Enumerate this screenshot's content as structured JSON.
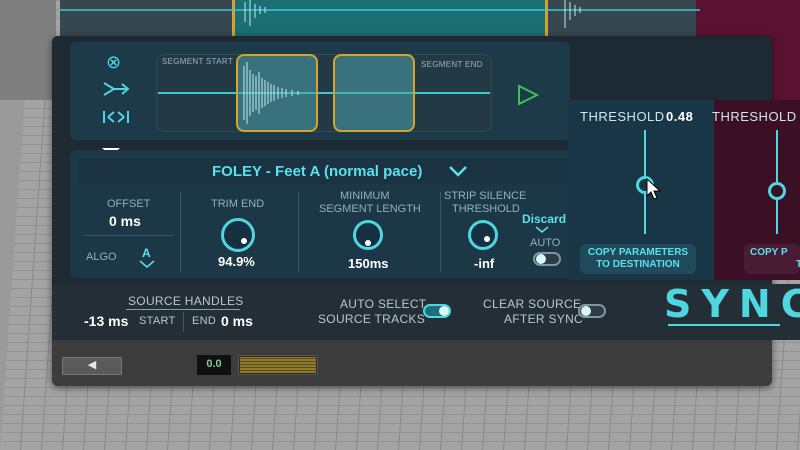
{
  "segment_editor": {
    "start_label": "SEGMENT START",
    "end_label": "SEGMENT END"
  },
  "preset": {
    "name": "FOLEY - Feet A (normal pace)"
  },
  "params": {
    "offset_label": "OFFSET",
    "offset_value": "0 ms",
    "algo_label": "ALGO",
    "algo_value": "A",
    "trim_end_label": "TRIM END",
    "trim_end_value": "94.9%",
    "min_segment_label_1": "MINIMUM",
    "min_segment_label_2": "SEGMENT LENGTH",
    "min_segment_value": "150ms",
    "strip_silence_label_1": "STRIP SILENCE",
    "strip_silence_label_2": "THRESHOLD",
    "strip_silence_value": "-inf",
    "discard_label": "Discard",
    "auto_label": "AUTO"
  },
  "threshold": {
    "label": "THRESHOLD",
    "value": "0.48",
    "copy_btn_line1": "COPY PARAMETERS",
    "copy_btn_line2": "TO DESTINATION",
    "label2": "THRESHOLD",
    "copy2_line1": "COPY P",
    "copy2_line2": "TO"
  },
  "bottom": {
    "source_handles_label": "SOURCE HANDLES",
    "start_value": "-13 ms",
    "start_label": "START",
    "end_label": "END",
    "end_value": "0 ms",
    "auto_select_line1": "AUTO SELECT",
    "auto_select_line2": "SOURCE TRACKS",
    "clear_source_line1": "CLEAR SOURCE",
    "clear_source_line2": "AFTER SYNC",
    "logo": "SYNC"
  },
  "footer": {
    "meter_value": "0.0"
  },
  "colors": {
    "accent": "#4fd6e0",
    "segment_border": "#d6a42c",
    "panel": "#1c3746"
  }
}
